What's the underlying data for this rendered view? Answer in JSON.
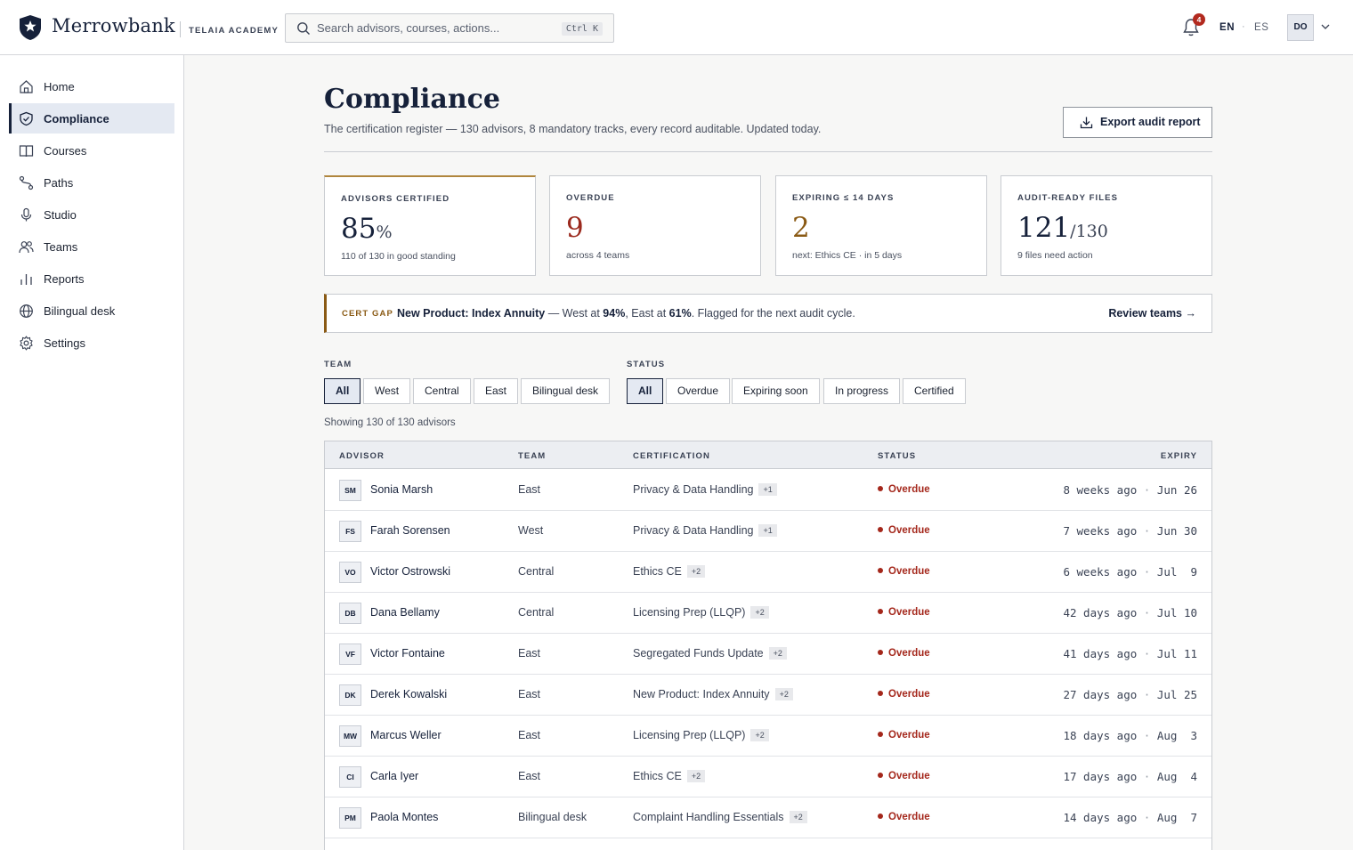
{
  "brand": {
    "name": "Merrowbank",
    "sub": "TELAIA ACADEMY"
  },
  "search": {
    "placeholder": "Search advisors, courses, actions...",
    "shortcut": "Ctrl K"
  },
  "topbar": {
    "notifications_count": "4",
    "lang_active": "EN",
    "lang_sep": "·",
    "lang_other": "ES",
    "user_initials": "DO"
  },
  "sidebar": {
    "items": [
      {
        "label": "Home",
        "icon": "home-icon"
      },
      {
        "label": "Compliance",
        "icon": "shield-check-icon"
      },
      {
        "label": "Courses",
        "icon": "book-open-icon"
      },
      {
        "label": "Paths",
        "icon": "route-icon"
      },
      {
        "label": "Studio",
        "icon": "microphone-icon"
      },
      {
        "label": "Teams",
        "icon": "users-icon"
      },
      {
        "label": "Reports",
        "icon": "bar-chart-icon"
      },
      {
        "label": "Bilingual desk",
        "icon": "globe-icon"
      },
      {
        "label": "Settings",
        "icon": "gear-icon"
      }
    ],
    "active": "Compliance"
  },
  "page": {
    "title": "Compliance",
    "subtitle": "The certification register — 130 advisors, 8 mandatory tracks, every record auditable. Updated today.",
    "export_label": "Export audit report"
  },
  "kpis": [
    {
      "label": "ADVISORS CERTIFIED",
      "value": "85",
      "unit": "%",
      "foot": "110 of 130 in good standing"
    },
    {
      "label": "OVERDUE",
      "value": "9",
      "unit": "",
      "foot": "across 4 teams"
    },
    {
      "label": "EXPIRING ≤ 14 DAYS",
      "value": "2",
      "unit": "",
      "foot": "next: Ethics CE · in 5 days"
    },
    {
      "label": "AUDIT-READY FILES",
      "value": "121",
      "unit": "/130",
      "foot": "9 files need action"
    }
  ],
  "gap": {
    "tag": "CERT GAP",
    "product": "New Product: Index Annuity",
    "text_a": " — West at ",
    "west": "94%",
    "text_b": ", East at ",
    "east": "61%",
    "text_c": ". Flagged for the next audit cycle.",
    "link": "Review teams →"
  },
  "filters": {
    "team_label": "TEAM",
    "team_options": [
      "All",
      "West",
      "Central",
      "East",
      "Bilingual desk"
    ],
    "team_selected": "All",
    "status_label": "STATUS",
    "status_options": [
      "All",
      "Overdue",
      "Expiring soon",
      "In progress",
      "Certified"
    ],
    "status_selected": "All"
  },
  "showing": "Showing 130 of 130 advisors",
  "table": {
    "columns": [
      "ADVISOR",
      "TEAM",
      "CERTIFICATION",
      "STATUS",
      "EXPIRY"
    ],
    "rows": [
      {
        "initials": "SM",
        "name": "Sonia Marsh",
        "team": "East",
        "cert": "Privacy & Data Handling",
        "extra": "+1",
        "status": "Overdue",
        "ago": "8 weeks ago",
        "date": "Jun 26"
      },
      {
        "initials": "FS",
        "name": "Farah Sorensen",
        "team": "West",
        "cert": "Privacy & Data Handling",
        "extra": "+1",
        "status": "Overdue",
        "ago": "7 weeks ago",
        "date": "Jun 30"
      },
      {
        "initials": "VO",
        "name": "Victor Ostrowski",
        "team": "Central",
        "cert": "Ethics CE",
        "extra": "+2",
        "status": "Overdue",
        "ago": "6 weeks ago",
        "date": "Jul  9"
      },
      {
        "initials": "DB",
        "name": "Dana Bellamy",
        "team": "Central",
        "cert": "Licensing Prep (LLQP)",
        "extra": "+2",
        "status": "Overdue",
        "ago": "42 days ago",
        "date": "Jul 10"
      },
      {
        "initials": "VF",
        "name": "Victor Fontaine",
        "team": "East",
        "cert": "Segregated Funds Update",
        "extra": "+2",
        "status": "Overdue",
        "ago": "41 days ago",
        "date": "Jul 11"
      },
      {
        "initials": "DK",
        "name": "Derek Kowalski",
        "team": "East",
        "cert": "New Product: Index Annuity",
        "extra": "+2",
        "status": "Overdue",
        "ago": "27 days ago",
        "date": "Jul 25"
      },
      {
        "initials": "MW",
        "name": "Marcus Weller",
        "team": "East",
        "cert": "Licensing Prep (LLQP)",
        "extra": "+2",
        "status": "Overdue",
        "ago": "18 days ago",
        "date": "Aug  3"
      },
      {
        "initials": "CI",
        "name": "Carla Iyer",
        "team": "East",
        "cert": "Ethics CE",
        "extra": "+2",
        "status": "Overdue",
        "ago": "17 days ago",
        "date": "Aug  4"
      },
      {
        "initials": "PM",
        "name": "Paola Montes",
        "team": "Bilingual desk",
        "cert": "Complaint Handling Essentials",
        "extra": "+2",
        "status": "Overdue",
        "ago": "14 days ago",
        "date": "Aug  7"
      }
    ]
  },
  "colors": {
    "navy": "#16213a",
    "overdue": "#a4271b",
    "amber": "#8a5a14",
    "gold_accent": "#b0863d"
  }
}
